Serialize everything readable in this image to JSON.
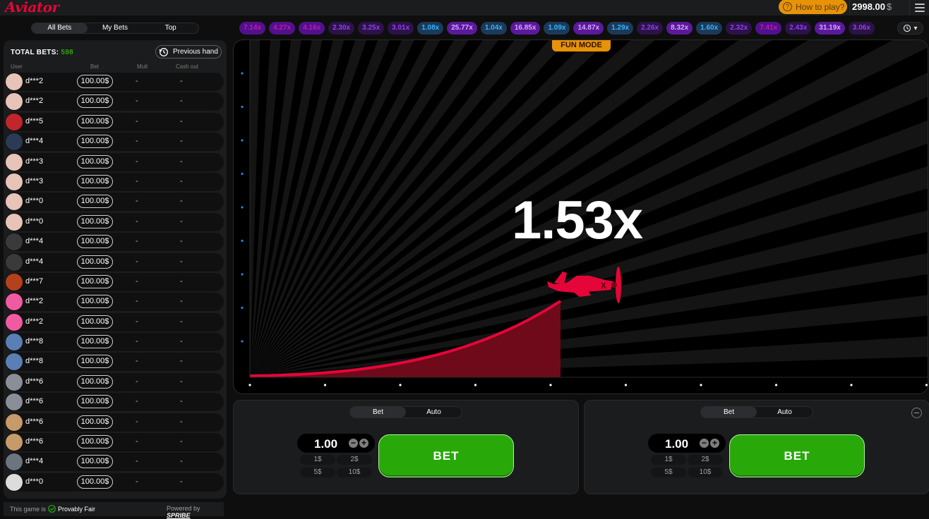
{
  "header": {
    "logo": "Aviator",
    "how_to_play": "How to play?",
    "balance": "2998.00",
    "currency": "$"
  },
  "left": {
    "tabs": [
      "All Bets",
      "My Bets",
      "Top"
    ],
    "total_bets_label": "TOTAL BETS:",
    "total_bets_count": "598",
    "previous_hand": "Previous hand",
    "columns": {
      "user": "User",
      "bet": "Bet",
      "mult": "Mult",
      "cashout": "Cash out"
    },
    "rows": [
      {
        "user": "d***2",
        "bet": "100.00$",
        "mult": "-",
        "cashout": "-",
        "avatar": "#e8c3b8"
      },
      {
        "user": "d***2",
        "bet": "100.00$",
        "mult": "-",
        "cashout": "-",
        "avatar": "#e8c3b8"
      },
      {
        "user": "d***5",
        "bet": "100.00$",
        "mult": "-",
        "cashout": "-",
        "avatar": "#c0262b"
      },
      {
        "user": "d***4",
        "bet": "100.00$",
        "mult": "-",
        "cashout": "-",
        "avatar": "#2b3b55"
      },
      {
        "user": "d***3",
        "bet": "100.00$",
        "mult": "-",
        "cashout": "-",
        "avatar": "#e8c3b8"
      },
      {
        "user": "d***3",
        "bet": "100.00$",
        "mult": "-",
        "cashout": "-",
        "avatar": "#e8c3b8"
      },
      {
        "user": "d***0",
        "bet": "100.00$",
        "mult": "-",
        "cashout": "-",
        "avatar": "#e8c3b8"
      },
      {
        "user": "d***0",
        "bet": "100.00$",
        "mult": "-",
        "cashout": "-",
        "avatar": "#e8c3b8"
      },
      {
        "user": "d***4",
        "bet": "100.00$",
        "mult": "-",
        "cashout": "-",
        "avatar": "#3a3a3a"
      },
      {
        "user": "d***4",
        "bet": "100.00$",
        "mult": "-",
        "cashout": "-",
        "avatar": "#3a3a3a"
      },
      {
        "user": "d***7",
        "bet": "100.00$",
        "mult": "-",
        "cashout": "-",
        "avatar": "#b5401c"
      },
      {
        "user": "d***2",
        "bet": "100.00$",
        "mult": "-",
        "cashout": "-",
        "avatar": "#f05aa0"
      },
      {
        "user": "d***2",
        "bet": "100.00$",
        "mult": "-",
        "cashout": "-",
        "avatar": "#f05aa0"
      },
      {
        "user": "d***8",
        "bet": "100.00$",
        "mult": "-",
        "cashout": "-",
        "avatar": "#5a7fb5"
      },
      {
        "user": "d***8",
        "bet": "100.00$",
        "mult": "-",
        "cashout": "-",
        "avatar": "#5a7fb5"
      },
      {
        "user": "d***6",
        "bet": "100.00$",
        "mult": "-",
        "cashout": "-",
        "avatar": "#8a8f97"
      },
      {
        "user": "d***6",
        "bet": "100.00$",
        "mult": "-",
        "cashout": "-",
        "avatar": "#8a8f97"
      },
      {
        "user": "d***6",
        "bet": "100.00$",
        "mult": "-",
        "cashout": "-",
        "avatar": "#c79a6a"
      },
      {
        "user": "d***6",
        "bet": "100.00$",
        "mult": "-",
        "cashout": "-",
        "avatar": "#c79a6a"
      },
      {
        "user": "d***4",
        "bet": "100.00$",
        "mult": "-",
        "cashout": "-",
        "avatar": "#6c7480"
      },
      {
        "user": "d***0",
        "bet": "100.00$",
        "mult": "-",
        "cashout": "-",
        "avatar": "#dcdcdc"
      }
    ],
    "footer": {
      "provably_prefix": "This game is",
      "provably_fair": "Provably Fair",
      "powered_by": "Powered by",
      "brand": "SPRIBE"
    }
  },
  "history": [
    {
      "value": "7.14x",
      "kind": "purple"
    },
    {
      "value": "4.27x",
      "kind": "purple"
    },
    {
      "value": "4.16x",
      "kind": "purple"
    },
    {
      "value": "2.30x",
      "kind": "violet"
    },
    {
      "value": "3.25x",
      "kind": "violet"
    },
    {
      "value": "3.01x",
      "kind": "violet"
    },
    {
      "value": "1.08x",
      "kind": "blue"
    },
    {
      "value": "25.77x",
      "kind": "hot"
    },
    {
      "value": "1.04x",
      "kind": "blue"
    },
    {
      "value": "16.85x",
      "kind": "hot"
    },
    {
      "value": "1.09x",
      "kind": "blue"
    },
    {
      "value": "14.87x",
      "kind": "hot"
    },
    {
      "value": "1.29x",
      "kind": "blue"
    },
    {
      "value": "2.26x",
      "kind": "violet"
    },
    {
      "value": "8.32x",
      "kind": "hot"
    },
    {
      "value": "1.60x",
      "kind": "blue"
    },
    {
      "value": "2.32x",
      "kind": "violet"
    },
    {
      "value": "7.41x",
      "kind": "purple"
    },
    {
      "value": "2.43x",
      "kind": "violet"
    },
    {
      "value": "31.19x",
      "kind": "hot"
    },
    {
      "value": "3.06x",
      "kind": "violet"
    }
  ],
  "game": {
    "fun_mode": "FUN MODE",
    "multiplier": "1.53x"
  },
  "bet_panels": [
    {
      "tabs": [
        "Bet",
        "Auto"
      ],
      "amount": "1.00",
      "quick": [
        "1$",
        "2$",
        "5$",
        "10$"
      ],
      "button": "BET"
    },
    {
      "tabs": [
        "Bet",
        "Auto"
      ],
      "amount": "1.00",
      "quick": [
        "1$",
        "2$",
        "5$",
        "10$"
      ],
      "button": "BET"
    }
  ],
  "colors": {
    "accent_red": "#e50539",
    "bet_green": "#28a909",
    "fun_orange": "#e69308"
  }
}
